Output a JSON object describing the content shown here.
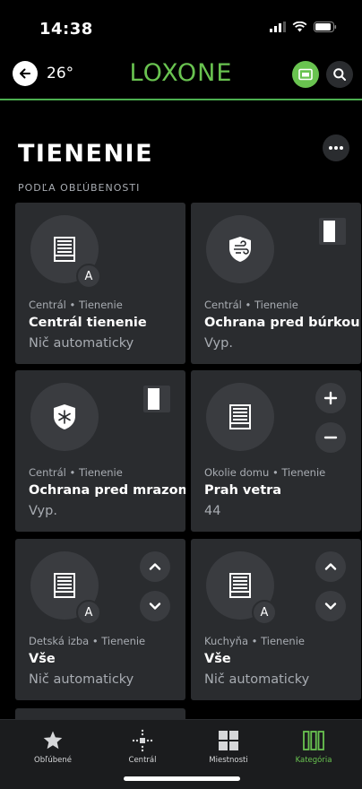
{
  "status_bar": {
    "time": "14:38"
  },
  "header": {
    "temperature": "26°",
    "logo": "LOXONE"
  },
  "page": {
    "title": "TIENENIE",
    "section_label": "PODĽA OBĽÚBENOSTI"
  },
  "cards": [
    {
      "subtitle": "Centrál • Tienenie",
      "name": "Centrál tienenie",
      "status": "Nič automaticky",
      "badge": "A"
    },
    {
      "subtitle": "Centrál • Tienenie",
      "name": "Ochrana pred búrkou",
      "status": "Vyp."
    },
    {
      "subtitle": "Centrál • Tienenie",
      "name": "Ochrana pred mrazom",
      "status": "Vyp."
    },
    {
      "subtitle": "Okolie domu • Tienenie",
      "name": "Prah vetra",
      "status": "44"
    },
    {
      "subtitle": "Detská izba • Tienenie",
      "name": "Vše",
      "status": "Nič automaticky",
      "badge": "A"
    },
    {
      "subtitle": "Kuchyňa • Tienenie",
      "name": "Vše",
      "status": "Nič automaticky",
      "badge": "A"
    }
  ],
  "tabs": [
    {
      "label": "Obľúbené"
    },
    {
      "label": "Centrál"
    },
    {
      "label": "Miestnosti"
    },
    {
      "label": "Kategória"
    }
  ],
  "colors": {
    "accent": "#69c350",
    "card_bg": "#2a2c2f",
    "muted_text": "#a8acb2"
  }
}
